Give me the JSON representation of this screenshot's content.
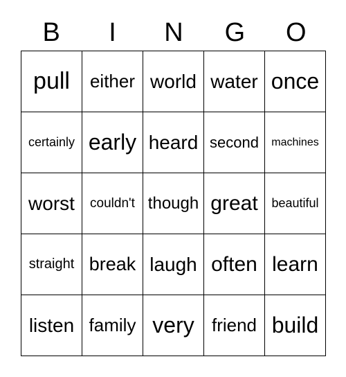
{
  "header": [
    "B",
    "I",
    "N",
    "G",
    "O"
  ],
  "cells": [
    [
      "pull",
      "either",
      "world",
      "water",
      "once"
    ],
    [
      "certainly",
      "early",
      "heard",
      "second",
      "machines"
    ],
    [
      "worst",
      "couldn't",
      "though",
      "great",
      "beautiful"
    ],
    [
      "straight",
      "break",
      "laugh",
      "often",
      "learn"
    ],
    [
      "listen",
      "family",
      "very",
      "friend",
      "build"
    ]
  ]
}
